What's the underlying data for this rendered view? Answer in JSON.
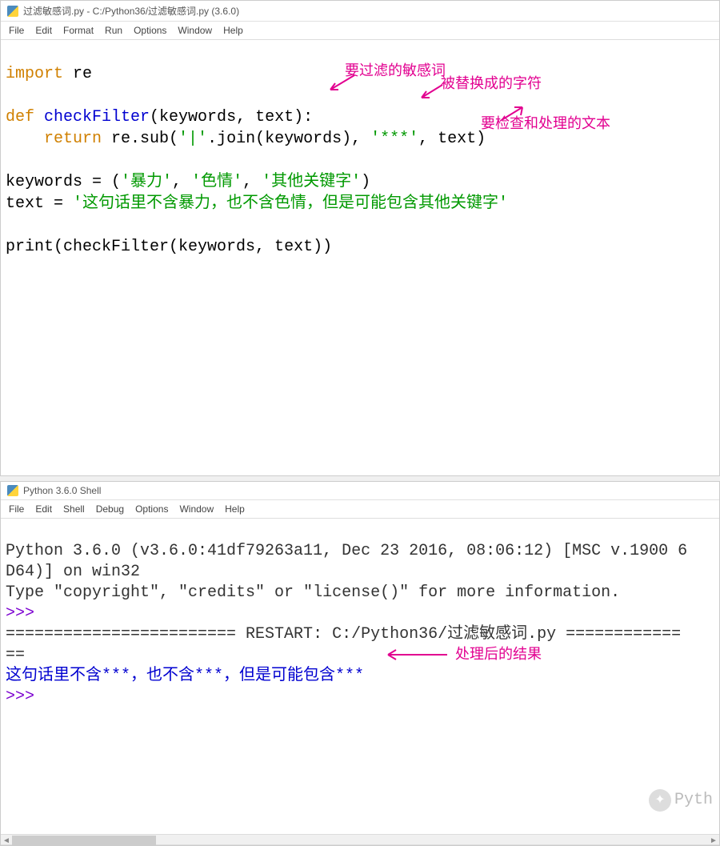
{
  "editor": {
    "title": "过滤敏感词.py - C:/Python36/过滤敏感词.py (3.6.0)",
    "menu": [
      "File",
      "Edit",
      "Format",
      "Run",
      "Options",
      "Window",
      "Help"
    ],
    "code": {
      "l1_import": "import",
      "l1_re": " re",
      "l3_def": "def",
      "l3_fn": " checkFilter",
      "l3_sig": "(keywords, text):",
      "l4_ret": "    return",
      "l4_a": " re.sub(",
      "l4_s1": "'|'",
      "l4_b": ".join(keywords), ",
      "l4_s2": "'***'",
      "l4_c": ", text)",
      "l6": "keywords = (",
      "l6_s1": "'暴力'",
      "l6_c1": ", ",
      "l6_s2": "'色情'",
      "l6_c2": ", ",
      "l6_s3": "'其他关键字'",
      "l6_end": ")",
      "l7": "text = ",
      "l7_s": "'这句话里不含暴力，也不含色情，但是可能包含其他关键字'",
      "l9_a": "print",
      "l9_b": "(checkFilter(keywords, text))"
    },
    "annotations": {
      "a1": "要过滤的敏感词",
      "a2": "被替换成的字符",
      "a3": "要检查和处理的文本"
    }
  },
  "shell": {
    "title": "Python 3.6.0 Shell",
    "menu": [
      "File",
      "Edit",
      "Shell",
      "Debug",
      "Options",
      "Window",
      "Help"
    ],
    "banner1": "Python 3.6.0 (v3.6.0:41df79263a11, Dec 23 2016, 08:06:12) [MSC v.1900 6",
    "banner2": "D64)] on win32",
    "banner3": "Type \"copyright\", \"credits\" or \"license()\" for more information.",
    "prompt": ">>> ",
    "restart": "======================== RESTART: C:/Python36/过滤敏感词.py ============",
    "restart2": "==",
    "result": "这句话里不含***，也不含***，但是可能包含***",
    "annotation": "处理后的结果",
    "watermark": "Pyth"
  }
}
